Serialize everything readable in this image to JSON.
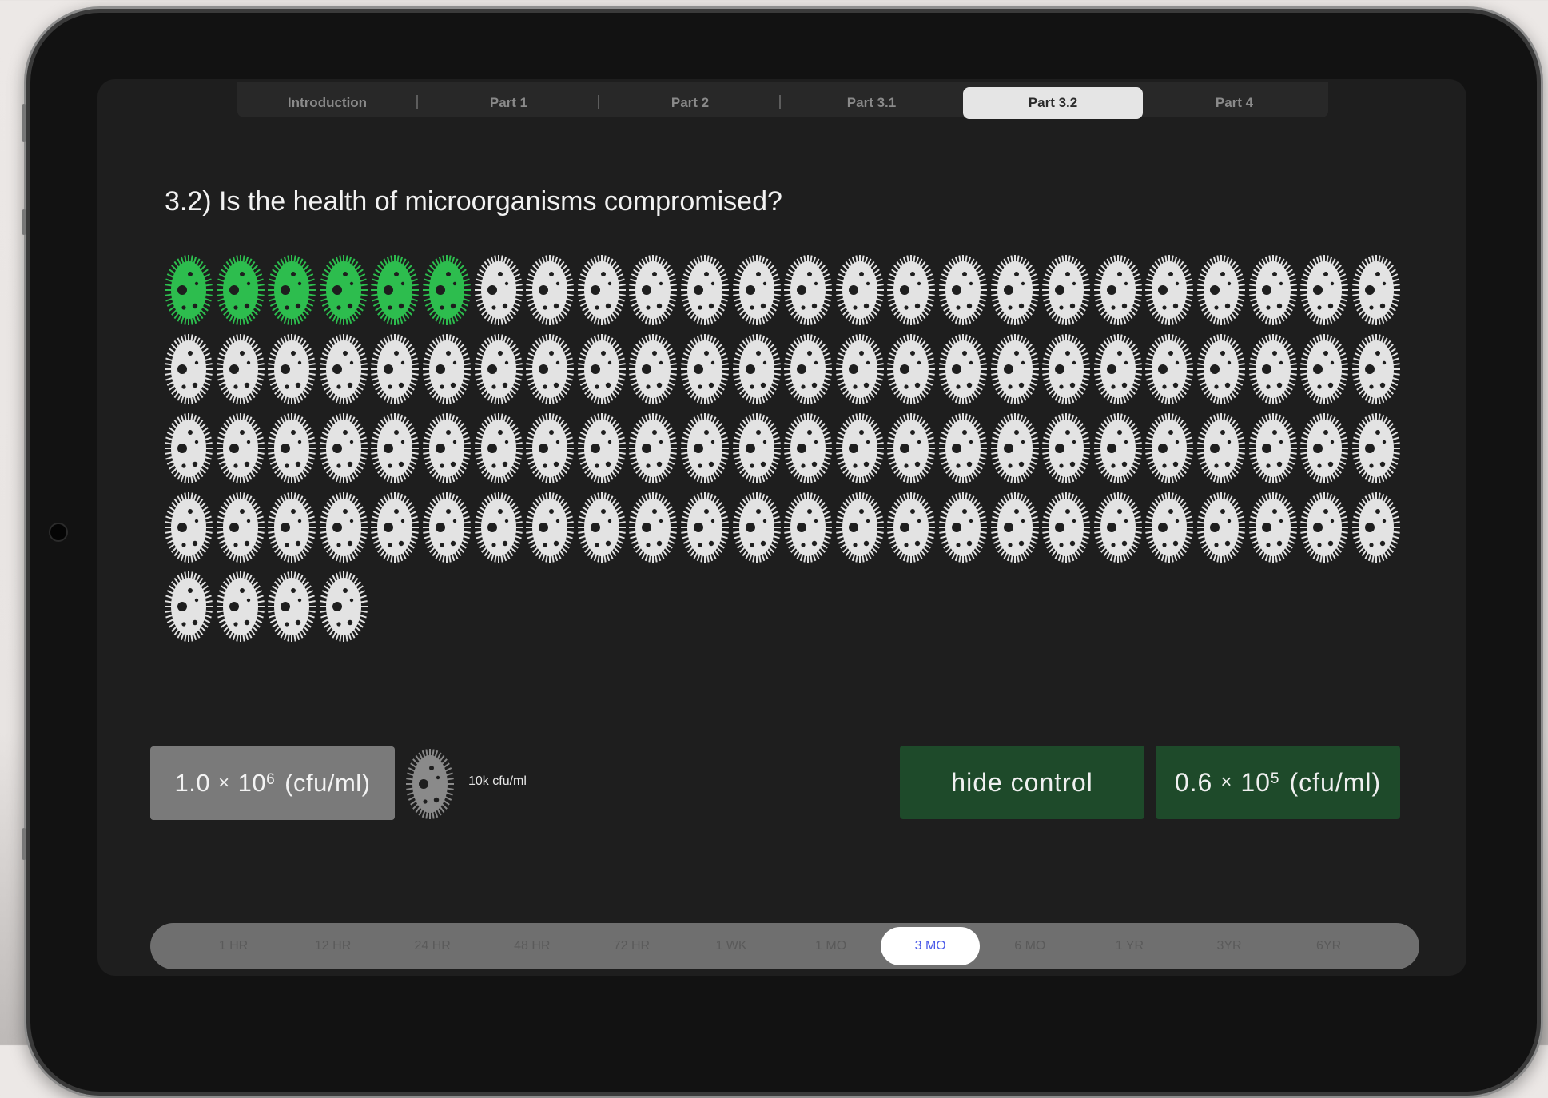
{
  "tabs": [
    {
      "label": "Introduction",
      "active": false
    },
    {
      "label": "Part 1",
      "active": false
    },
    {
      "label": "Part 2",
      "active": false
    },
    {
      "label": "Part 3.1",
      "active": false
    },
    {
      "label": "Part  3.2",
      "active": true
    },
    {
      "label": "Part 4",
      "active": false
    }
  ],
  "question": "3.2) Is the health of microorganisms compromised?",
  "grid": {
    "total_count": 100,
    "highlighted_count": 6,
    "per_row": 24,
    "icon": "microbe-icon",
    "highlight_color": "#2dbd4e",
    "default_color": "#e3e3e3"
  },
  "control_count": {
    "mantissa": "1.0",
    "base": "10",
    "exponent": "6",
    "unit": "(cfu/ml)"
  },
  "legend": {
    "icon": "microbe-icon",
    "label": "10k cfu/ml",
    "color": "#8a8a8a"
  },
  "hide_control_label": "hide control",
  "treated_count": {
    "mantissa": "0.6",
    "base": "10",
    "exponent": "5",
    "unit": "(cfu/ml)"
  },
  "timeline": {
    "items": [
      "1 HR",
      "12 HR",
      "24 HR",
      "48 HR",
      "72 HR",
      "1 WK",
      "1 MO",
      "3 MO",
      "6 MO",
      "1 YR",
      "3YR",
      "6YR"
    ],
    "selected": "3 MO"
  },
  "colors": {
    "green_button": "#1e4a2a",
    "screen_bg": "#1e1e1e",
    "timeline_accent": "#4a59e8"
  }
}
